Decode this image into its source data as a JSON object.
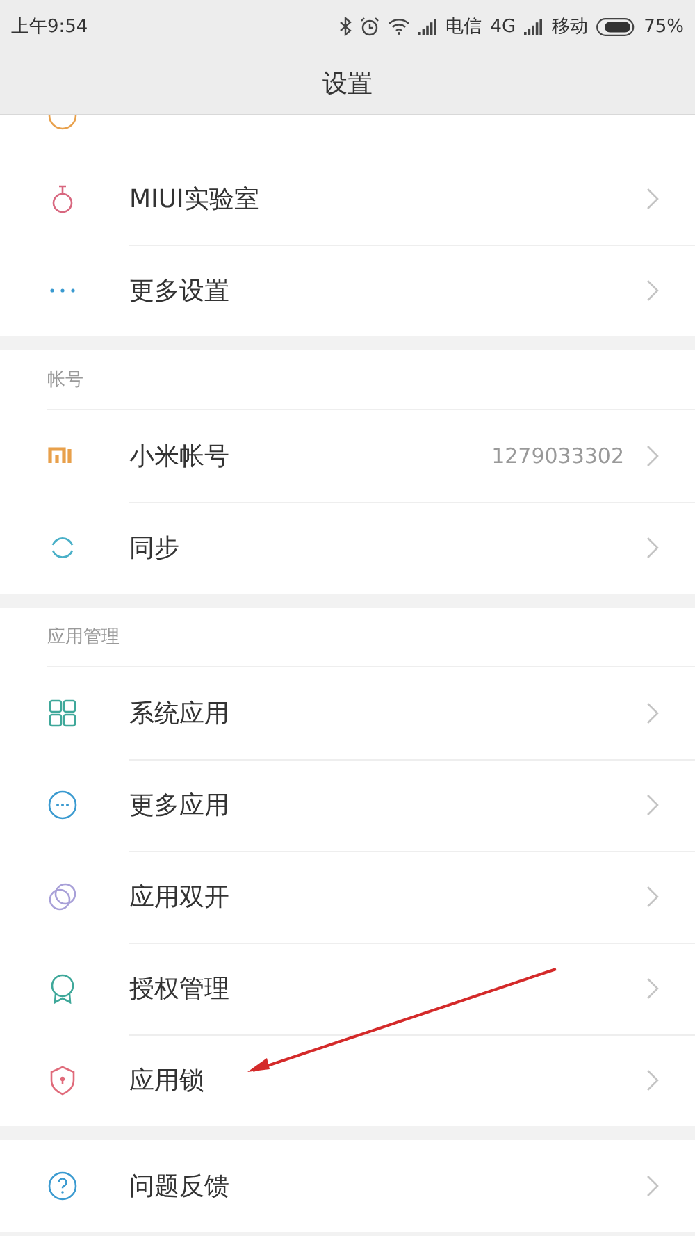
{
  "status_bar": {
    "time": "上午9:54",
    "carrier_1": "电信",
    "network": "4G",
    "carrier_2": "移动",
    "battery": "75%"
  },
  "header": {
    "title": "设置"
  },
  "sections": [
    {
      "items": [
        {
          "kind": "lab",
          "label": "MIUI实验室"
        },
        {
          "kind": "more",
          "label": "更多设置"
        }
      ]
    },
    {
      "heading": "帐号",
      "items": [
        {
          "kind": "mi",
          "label": "小米帐号",
          "value": "1279033302"
        },
        {
          "kind": "sync",
          "label": "同步"
        }
      ]
    },
    {
      "heading": "应用管理",
      "items": [
        {
          "kind": "grid",
          "label": "系统应用"
        },
        {
          "kind": "chat",
          "label": "更多应用"
        },
        {
          "kind": "dual",
          "label": "应用双开"
        },
        {
          "kind": "award",
          "label": "授权管理"
        },
        {
          "kind": "shield",
          "label": "应用锁"
        }
      ]
    },
    {
      "items": [
        {
          "kind": "help",
          "label": "问题反馈"
        }
      ]
    }
  ]
}
